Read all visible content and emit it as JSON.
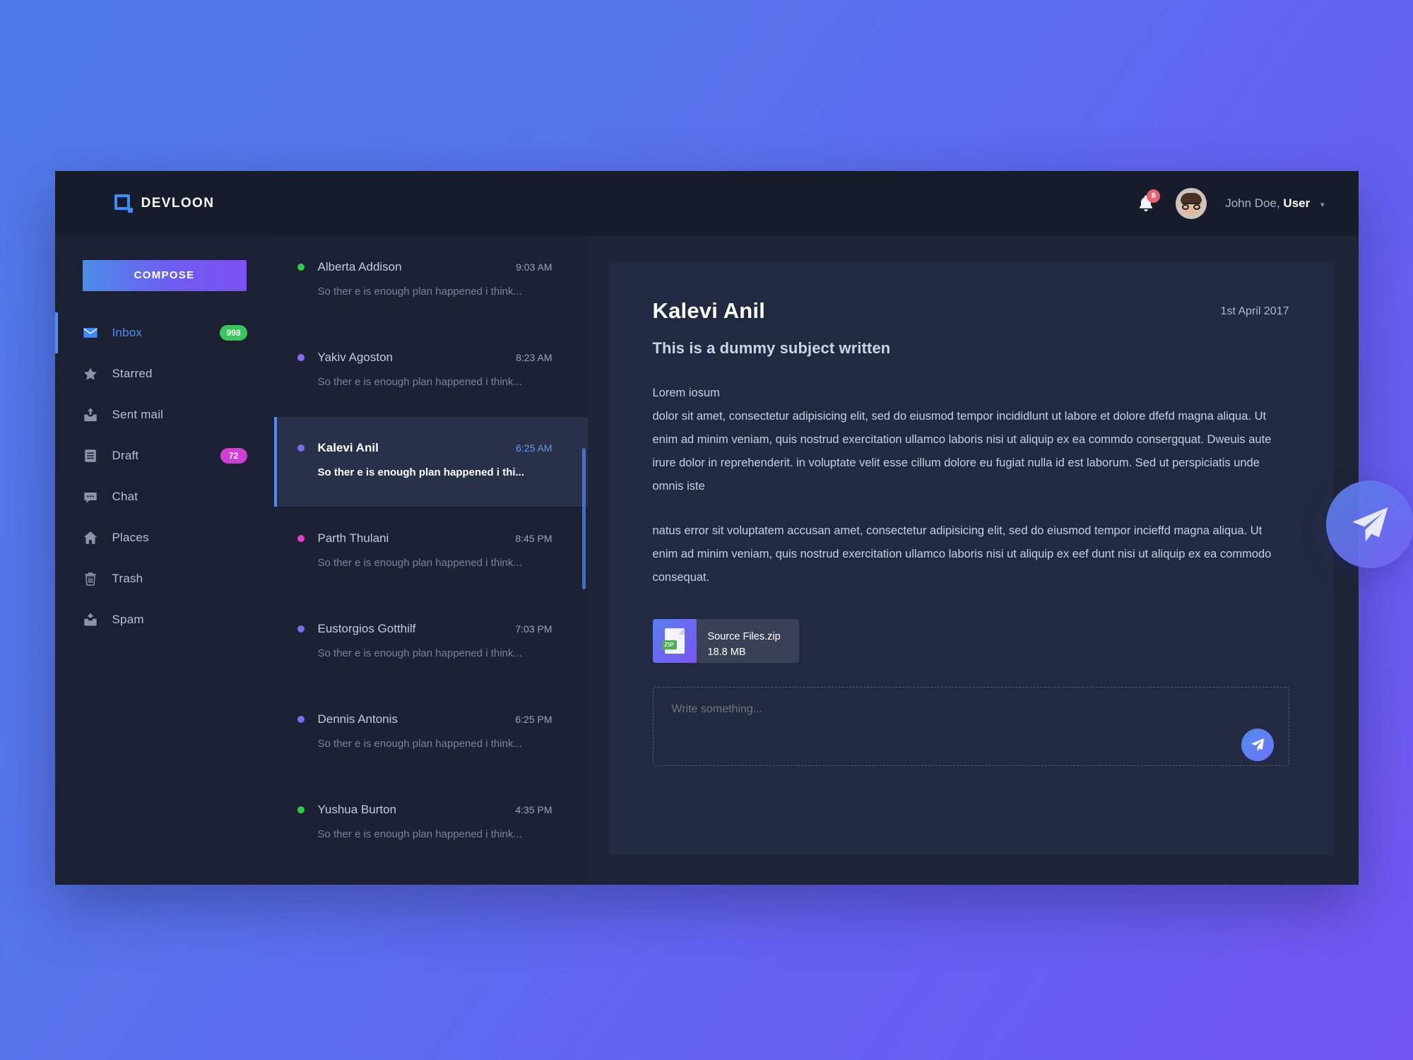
{
  "brand": {
    "name": "DEVLOON",
    "icon": "devloon-logo-icon"
  },
  "topbar": {
    "notifications": {
      "icon": "bell-icon",
      "count": "8"
    },
    "user": {
      "name": "John Doe,",
      "role": "User",
      "caret": "▾",
      "avatar_icon": "avatar-icon"
    }
  },
  "sidebar": {
    "compose_label": "COMPOSE",
    "items": [
      {
        "label": "Inbox",
        "icon": "envelope-icon",
        "badge": "998",
        "badge_color": "#38c75a",
        "active": true
      },
      {
        "label": "Starred",
        "icon": "star-icon",
        "badge": "",
        "badge_color": "",
        "active": false
      },
      {
        "label": "Sent mail",
        "icon": "sent-mail-icon",
        "badge": "",
        "badge_color": "",
        "active": false
      },
      {
        "label": "Draft",
        "icon": "document-icon",
        "badge": "72",
        "badge_color": "#cf3fd6",
        "active": false
      },
      {
        "label": "Chat",
        "icon": "chat-bubble-icon",
        "badge": "",
        "badge_color": "",
        "active": false
      },
      {
        "label": "Places",
        "icon": "home-icon",
        "badge": "",
        "badge_color": "",
        "active": false
      },
      {
        "label": "Trash",
        "icon": "trash-icon",
        "badge": "",
        "badge_color": "",
        "active": false
      },
      {
        "label": "Spam",
        "icon": "spam-inbox-icon",
        "badge": "",
        "badge_color": "",
        "active": false
      }
    ]
  },
  "mail_list": {
    "items": [
      {
        "name": "Alberta Addison",
        "time": "9:03 AM",
        "snippet": "So ther e is enough plan happened i think...",
        "dot_color": "#2ecc40",
        "selected": false
      },
      {
        "name": "Yakiv Agoston",
        "time": "8:23 AM",
        "snippet": "So ther e is enough plan happened i think...",
        "dot_color": "#8e6bf5",
        "selected": false
      },
      {
        "name": "Kalevi Anil",
        "time": "6:25 AM",
        "snippet": "So ther e is enough plan happened i thi...",
        "dot_color": "#7b6bf0",
        "selected": true
      },
      {
        "name": "Parth Thulani",
        "time": "8:45 PM",
        "snippet": "So ther e is enough plan happened i think...",
        "dot_color": "#e040c8",
        "selected": false
      },
      {
        "name": "Eustorgios Gotthilf",
        "time": "7:03 PM",
        "snippet": "So ther e is enough plan happened i think...",
        "dot_color": "#7b6bf0",
        "selected": false
      },
      {
        "name": "Dennis Antonis",
        "time": "6:25 PM",
        "snippet": "So ther e is enough plan happened i think...",
        "dot_color": "#7b6bf0",
        "selected": false
      },
      {
        "name": "Yushua Burton",
        "time": "4:35 PM",
        "snippet": "So ther e is enough plan happened i think...",
        "dot_color": "#2ecc40",
        "selected": false
      }
    ]
  },
  "detail": {
    "sender": "Kalevi Anil",
    "date": "1st April 2017",
    "subject": "This is a dummy subject written",
    "paragraph_1": "Lorem iosum",
    "paragraph_2": "dolor sit amet, consectetur adipisicing elit, sed do eiusmod tempor incididlunt ut labore et dolore dfefd magna aliqua. Ut enim ad minim veniam, quis nostrud exercitation ullamco laboris nisi ut aliquip ex ea commdo consergquat. Dweuis aute irure dolor in reprehenderit. in voluptate velit esse cillum dolore eu fugiat nulla id est laborum. Sed ut perspiciatis unde omnis iste",
    "paragraph_3": "natus error sit voluptatem accusan amet, consectetur adipisicing elit, sed do eiusmod tempor incieffd magna aliqua. Ut enim ad minim veniam, quis nostrud exercitation ullamco laboris nisi ut aliquip ex eef dunt nisi ut aliquip ex ea commodo consequat.",
    "attachment": {
      "name": "Source Files.zip",
      "size": "18.8 MB",
      "type_tag": "ZIP",
      "icon": "zip-file-icon"
    },
    "reply_placeholder": "Write something...",
    "reply_value": "",
    "send_icon": "paper-plane-icon"
  },
  "fab": {
    "icon": "paper-plane-icon"
  },
  "colors": {
    "accent_blue": "#4f8ef5",
    "accent_purple": "#7a51f2",
    "badge_green": "#38c75a",
    "badge_magenta": "#cf3fd6",
    "notif_red": "#e8636c",
    "window_bg": "#1c2336",
    "topbar_bg": "#161c2c",
    "card_bg": "#222a41",
    "selected_row": "#29314a"
  }
}
